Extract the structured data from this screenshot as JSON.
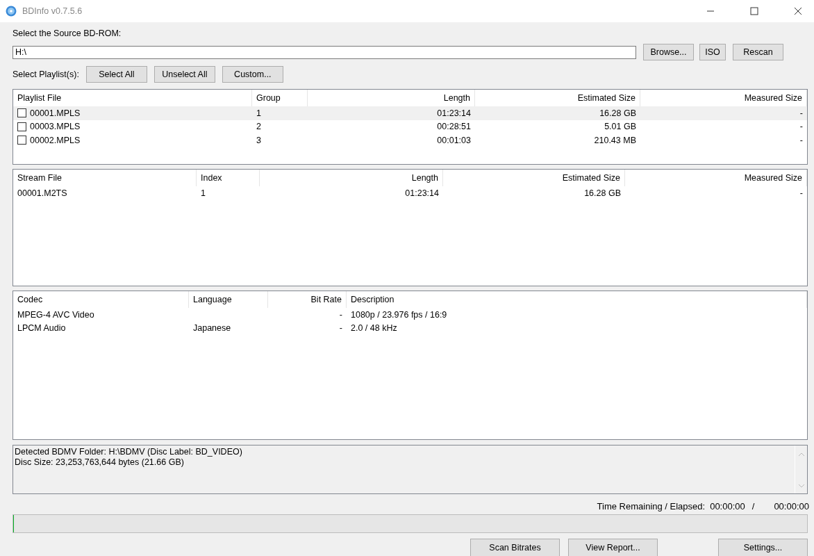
{
  "window": {
    "title": "BDInfo v0.7.5.6"
  },
  "source": {
    "label": "Select the Source BD-ROM:",
    "value": "H:\\",
    "buttons": [
      "Browse...",
      "ISO",
      "Rescan"
    ]
  },
  "playlist_select": {
    "label": "Select Playlist(s):",
    "buttons": [
      "Select All",
      "Unselect All",
      "Custom..."
    ]
  },
  "playlists": {
    "columns": [
      "Playlist File",
      "Group",
      "Length",
      "Estimated Size",
      "Measured Size"
    ],
    "rows": [
      {
        "cells": [
          "00001.MPLS",
          "1",
          "01:23:14",
          "16.28 GB",
          "-"
        ],
        "checked": false,
        "selected": true
      },
      {
        "cells": [
          "00003.MPLS",
          "2",
          "00:28:51",
          "5.01 GB",
          "-"
        ],
        "checked": false,
        "selected": false
      },
      {
        "cells": [
          "00002.MPLS",
          "3",
          "00:01:03",
          "210.43 MB",
          "-"
        ],
        "checked": false,
        "selected": false
      }
    ]
  },
  "streams": {
    "columns": [
      "Stream File",
      "Index",
      "Length",
      "Estimated Size",
      "Measured Size"
    ],
    "rows": [
      {
        "cells": [
          "00001.M2TS",
          "1",
          "01:23:14",
          "16.28 GB",
          "-"
        ]
      }
    ]
  },
  "codecs": {
    "columns": [
      "Codec",
      "Language",
      "Bit Rate",
      "Description"
    ],
    "rows": [
      {
        "cells": [
          "MPEG-4 AVC Video",
          "",
          "-",
          "1080p / 23.976 fps / 16:9"
        ]
      },
      {
        "cells": [
          "LPCM Audio",
          "Japanese",
          "-",
          "2.0 / 48 kHz"
        ]
      }
    ]
  },
  "log": [
    "Detected BDMV Folder: H:\\BDMV (Disc Label: BD_VIDEO)",
    "Disc Size: 23,253,763,644 bytes (21.66 GB)"
  ],
  "time": {
    "label": "Time Remaining / Elapsed:",
    "remaining": "00:00:00",
    "separator": "/",
    "elapsed": "00:00:00"
  },
  "progress": {
    "level": 0
  },
  "buttons": [
    "Scan Bitrates",
    "View Report...",
    "Settings..."
  ]
}
